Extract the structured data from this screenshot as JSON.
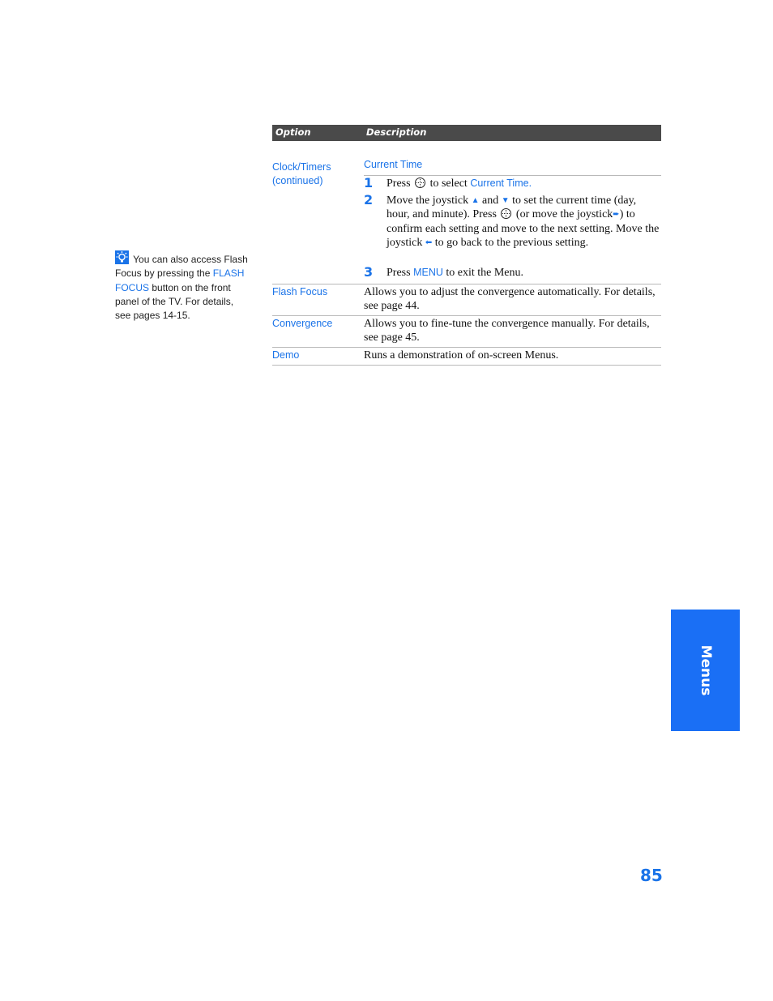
{
  "table": {
    "headers": {
      "option": "Option",
      "description": "Description"
    },
    "rows": [
      {
        "option_line1": "Clock/Timers",
        "option_line2": "(continued)",
        "subheading": "Current Time",
        "steps": [
          {
            "num": "1",
            "parts": [
              "Press",
              "to select",
              "Current Time."
            ]
          },
          {
            "num": "2",
            "parts": [
              "Move the joystick",
              "and",
              "to set the current time (day, hour, and minute). Press",
              "(or move the joystick",
              ") to confirm each setting and move to the next setting. Move the joystick",
              "to go back to the previous setting."
            ]
          },
          {
            "num": "3",
            "parts": [
              "Press",
              "MENU",
              "to exit the Menu."
            ]
          }
        ]
      },
      {
        "option": "Flash Focus",
        "description": "Allows you to adjust the convergence automatically. For details, see page 44."
      },
      {
        "option": "Convergence",
        "description": "Allows you to fine-tune the convergence manually. For details, see page 45."
      },
      {
        "option": "Demo",
        "description": "Runs a demonstration of on-screen Menus."
      }
    ]
  },
  "tip": {
    "icon": "lightbulb-icon",
    "text_before": "You can also access Flash Focus by pressing the",
    "highlight": "FLASH FOCUS",
    "text_after": "button on the front panel of the TV. For details, see pages 14-15."
  },
  "icons": {
    "joystick": "joystick-press-icon",
    "up": "▲",
    "down": "▼",
    "right": "➨",
    "left": "⬅"
  },
  "side_tab": {
    "label": "Menus"
  },
  "page_number": "85",
  "colors": {
    "accent": "#1a73e8",
    "tab": "#1a6ff5",
    "header": "#4a4a4a"
  }
}
